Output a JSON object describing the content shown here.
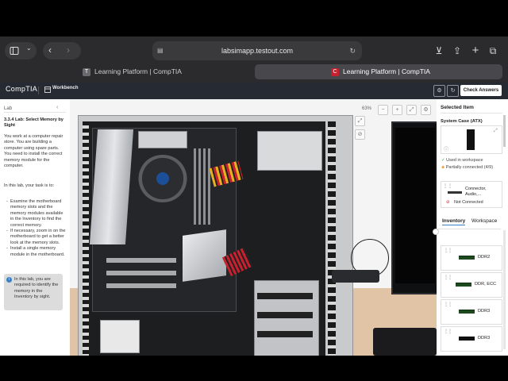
{
  "browser": {
    "url": "labsimapp.testout.com",
    "tabs": [
      {
        "label": "Learning Platform | CompTIA",
        "favicon": "T"
      },
      {
        "label": "Learning Platform | CompTIA",
        "favicon": "C"
      }
    ]
  },
  "app": {
    "logo": "CompTIA",
    "workbench_label": "Workbench",
    "check_answers_label": "Check Answers"
  },
  "lab": {
    "header": "Lab",
    "title": "3.3.4 Lab: Select Memory by Sight",
    "intro": "You work at a computer repair store. You are building a computer using spare parts. You need to install the correct memory module for the computer.",
    "task_intro": "In this lab, your task is to:",
    "tasks": [
      "Examine the motherboard memory slots and the memory modules available in the Inventory to find the correct memory.",
      "If necessary, zoom in on the motherboard to get a better look at the memory slots.",
      "Install a single memory module in the motherboard."
    ],
    "note": "In this lab, you are required to identify the memory in the Inventory by sight."
  },
  "workspace": {
    "zoom": "63%"
  },
  "selected_item": {
    "header": "Selected Item",
    "name": "System Case (ATX)",
    "used_in_workspace": "Used in workspace",
    "partially_connected": "Partially connected (4/9)",
    "connector_label": "Connector, Audio,...",
    "connector_status": "Not Connected"
  },
  "panel_tabs": {
    "inventory": "Inventory",
    "workspace": "Workspace"
  },
  "inventory": [
    {
      "label": "DDR2"
    },
    {
      "label": "DDR, ECC"
    },
    {
      "label": "DDR3"
    },
    {
      "label": "DDR3"
    }
  ]
}
